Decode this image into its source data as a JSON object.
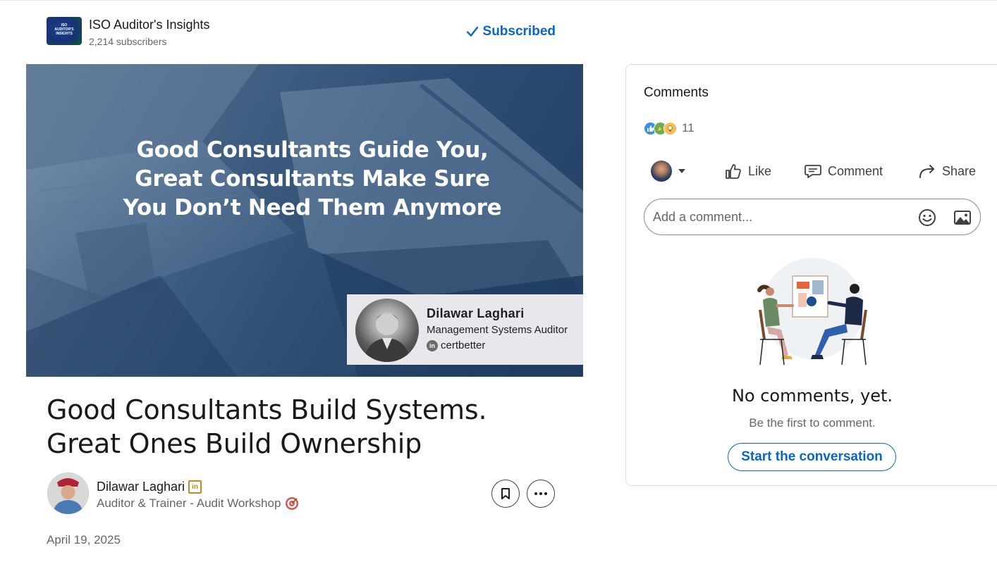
{
  "newsletter": {
    "logo_lines": [
      "ISO",
      "AUDITOR'S",
      "INSIGHTS"
    ],
    "name": "ISO Auditor's Insights",
    "subscribers": "2,214 subscribers",
    "subscribed_label": "Subscribed",
    "subscribed_icon": "check-icon",
    "accent_color": "#0a66c2"
  },
  "cover": {
    "heading_lines": [
      "Good Consultants Guide You,",
      "Great Consultants Make Sure",
      "You Don’t Need Them Anymore"
    ],
    "card": {
      "name": "Dilawar Laghari",
      "role": "Management Systems Auditor",
      "handle_icon": "linkedin-icon",
      "handle": "certbetter"
    }
  },
  "article": {
    "title": "Good Consultants Build Systems. Great Ones Build Ownership",
    "author": {
      "name": "Dilawar Laghari",
      "badge_icon": "linkedin-badge-icon",
      "headline": "Auditor & Trainer - Audit Workshop",
      "headline_icon": "target-icon"
    },
    "save_icon": "bookmark-icon",
    "more_icon": "more-icon",
    "date": "April 19, 2025"
  },
  "comments_panel": {
    "title": "Comments",
    "reaction_icons": [
      "like-reaction-icon",
      "celebrate-reaction-icon",
      "insightful-reaction-icon"
    ],
    "reaction_count": "11",
    "actions": {
      "like": "Like",
      "comment": "Comment",
      "share": "Share"
    },
    "input": {
      "placeholder": "Add a comment...",
      "value": ""
    },
    "empty_title": "No comments, yet.",
    "empty_subtitle": "Be the first to comment.",
    "start_button": "Start the conversation"
  }
}
